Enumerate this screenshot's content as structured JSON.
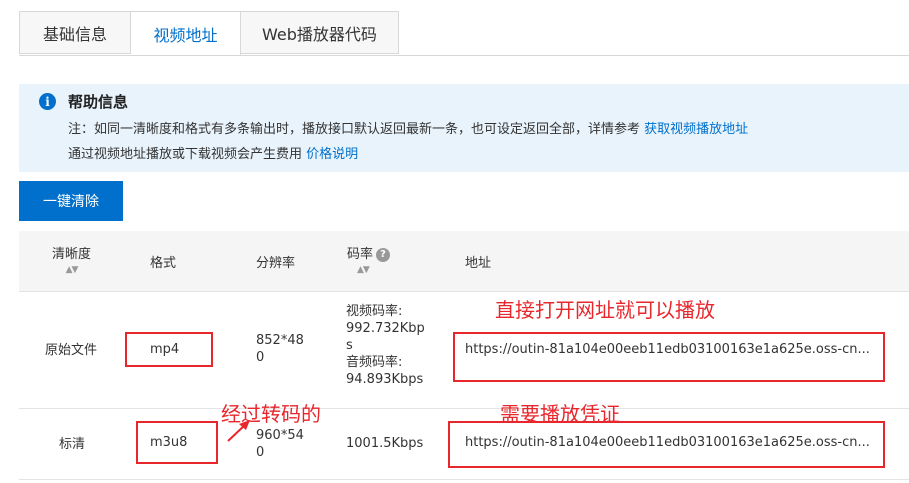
{
  "tabs": [
    {
      "label": "基础信息"
    },
    {
      "label": "视频地址"
    },
    {
      "label": "Web播放器代码"
    }
  ],
  "help": {
    "title": "帮助信息",
    "line1_text": "注：如同一清晰度和格式有多条输出时，播放接口默认返回最新一条，也可设定返回全部，详情参考",
    "line1_link": "获取视频播放地址",
    "line2_text": "通过视频地址播放或下载视频会产生费用",
    "line2_link": "价格说明"
  },
  "actions": {
    "clear_label": "一键清除"
  },
  "table": {
    "headers": {
      "definition": "清晰度",
      "format": "格式",
      "resolution": "分辨率",
      "bitrate": "码率",
      "address": "地址"
    },
    "rows": [
      {
        "definition": "原始文件",
        "format": "mp4",
        "resolution_l1": "852*48",
        "resolution_l2": "0",
        "bitrate_lines": [
          "视频码率:",
          "992.732Kbp",
          "s",
          "音频码率:",
          "94.893Kbps"
        ],
        "address": "https://outin-81a104e00eeb11edb03100163e1a625e.oss-cn..."
      },
      {
        "definition": "标清",
        "format": "m3u8",
        "resolution_l1": "960*54",
        "resolution_l2": "0",
        "bitrate": "1001.5Kbps",
        "address": "https://outin-81a104e00eeb11edb03100163e1a625e.oss-cn..."
      }
    ]
  },
  "annotations": {
    "direct_play": "直接打开网址就可以播放",
    "transcoded": "经过转码的",
    "needs_credential": "需要播放凭证"
  },
  "colors": {
    "accent": "#0070cc",
    "annotation_red": "#e8272d",
    "help_bg": "#e8f3fc"
  },
  "icons": {
    "info": "info-icon",
    "sort": "sort-icon",
    "help": "question-icon",
    "arrow": "arrow-icon"
  }
}
